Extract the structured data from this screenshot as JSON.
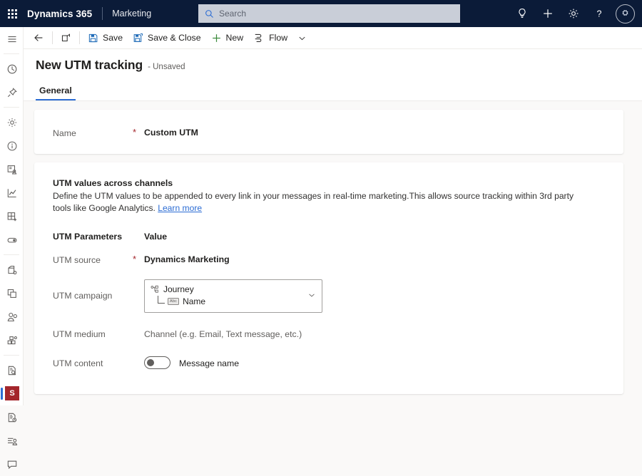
{
  "topbar": {
    "waffle_icon": "app-launcher-icon",
    "brand": "Dynamics 365",
    "app_name": "Marketing",
    "search": {
      "placeholder": "Search",
      "value": "",
      "icon": "search-icon"
    },
    "actions": [
      {
        "name": "lightbulb-icon",
        "tooltip": "Ideas"
      },
      {
        "name": "plus-icon",
        "tooltip": "New"
      },
      {
        "name": "gear-icon",
        "tooltip": "Settings"
      },
      {
        "name": "question-icon",
        "tooltip": "Help"
      }
    ],
    "avatar": {
      "name": "avatar",
      "glyph": "⛭"
    }
  },
  "rail": {
    "menu_icon": "hamburger-menu-icon",
    "items": [
      {
        "icon": "clock-recent-icon",
        "label": "Recent"
      },
      {
        "icon": "pin-icon",
        "label": "Pinned"
      },
      {
        "icon": "gear-icon",
        "label": "Settings"
      },
      {
        "icon": "info-circle-icon",
        "label": "Overview"
      },
      {
        "icon": "contact-card-icon",
        "label": "Contacts"
      },
      {
        "icon": "line-chart-icon",
        "label": "Analytics"
      },
      {
        "icon": "grid-plus-icon",
        "label": "New grid"
      },
      {
        "icon": "toggle-icon",
        "label": "Toggle"
      },
      {
        "icon": "calendar-settings-icon",
        "label": "Calendar"
      },
      {
        "icon": "layers-copy-icon",
        "label": "Duplicate"
      },
      {
        "icon": "person-add-icon",
        "label": "Leads"
      },
      {
        "icon": "segments-nodes-icon",
        "label": "Segments"
      },
      {
        "icon": "document-search-icon",
        "label": "Forms"
      },
      {
        "icon": "puzzle-piece-icon",
        "label": "UTM tracking",
        "active": true
      },
      {
        "icon": "document-clock-icon",
        "label": "Schedules"
      },
      {
        "icon": "list-person-icon",
        "label": "Audience"
      },
      {
        "icon": "chat-bubble-icon",
        "label": "Messages"
      }
    ],
    "app_tile": {
      "label": "S",
      "color": "#a4262c"
    }
  },
  "commandbar": {
    "back": {
      "label": "",
      "icon": "arrow-left-icon"
    },
    "popout": {
      "label": "",
      "icon": "open-in-new-window-icon"
    },
    "save": {
      "label": "Save",
      "icon": "save-floppy-icon"
    },
    "save_close": {
      "label": "Save & Close",
      "icon": "save-close-icon"
    },
    "new": {
      "label": "New",
      "icon": "plus-icon"
    },
    "flow": {
      "label": "Flow",
      "icon": "flow-icon",
      "chevron": "chevron-down-icon"
    }
  },
  "page": {
    "title": "New UTM tracking",
    "subtitle": "- Unsaved",
    "tabs": [
      {
        "label": "General",
        "active": true
      }
    ]
  },
  "name_card": {
    "label": "Name",
    "required": "*",
    "value": "Custom UTM"
  },
  "utm_card": {
    "section_title": "UTM values across channels",
    "description": "Define the UTM values to be appended to every link in your messages in real-time marketing.This allows source tracking within 3rd party tools like Google Analytics.",
    "learn_more": "Learn more",
    "columns": {
      "parameter": "UTM Parameters",
      "value": "Value"
    },
    "rows": {
      "source": {
        "label": "UTM source",
        "required": "*",
        "value": "Dynamics Marketing"
      },
      "campaign": {
        "label": "UTM campaign",
        "token_primary": "Journey",
        "token_primary_icon": "journey-branch-icon",
        "token_secondary": "Name",
        "token_secondary_icon": "abc-text-field-icon",
        "chevron": "chevron-down-icon"
      },
      "medium": {
        "label": "UTM medium",
        "value": "Channel (e.g. Email, Text message, etc.)"
      },
      "content": {
        "label": "UTM content",
        "toggle_state": "off",
        "value": "Message name"
      }
    }
  },
  "colors": {
    "nav_background": "#0b1b38",
    "accent": "#2b6cd4",
    "required_asterisk": "#a4262c",
    "page_background": "#faf9f8",
    "card_background": "#ffffff",
    "app_tile": "#a4262c"
  }
}
